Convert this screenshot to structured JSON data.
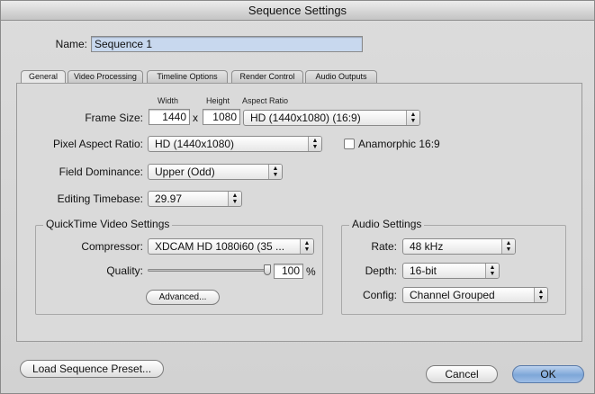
{
  "window": {
    "title": "Sequence Settings"
  },
  "name": {
    "label": "Name:",
    "value": "Sequence 1"
  },
  "tabs": [
    {
      "label": "General",
      "active": true
    },
    {
      "label": "Video Processing"
    },
    {
      "label": "Timeline Options"
    },
    {
      "label": "Render Control"
    },
    {
      "label": "Audio Outputs"
    }
  ],
  "general": {
    "frame_size": {
      "label": "Frame Size:",
      "width_header": "Width",
      "height_header": "Height",
      "aspect_header": "Aspect Ratio",
      "width": "1440",
      "separator": "x",
      "height": "1080",
      "aspect_ratio": "HD (1440x1080) (16:9)"
    },
    "pixel_aspect": {
      "label": "Pixel Aspect Ratio:",
      "value": "HD (1440x1080)"
    },
    "anamorphic": {
      "label": "Anamorphic 16:9",
      "checked": false
    },
    "field_dominance": {
      "label": "Field Dominance:",
      "value": "Upper (Odd)"
    },
    "editing_timebase": {
      "label": "Editing Timebase:",
      "value": "29.97"
    }
  },
  "quicktime": {
    "title": "QuickTime Video Settings",
    "compressor_label": "Compressor:",
    "compressor_value": "XDCAM HD 1080i60 (35 ...",
    "quality_label": "Quality:",
    "quality_value": "100",
    "quality_unit": "%",
    "quality_fraction": 1.0,
    "advanced_label": "Advanced..."
  },
  "audio": {
    "title": "Audio Settings",
    "rate_label": "Rate:",
    "rate_value": "48 kHz",
    "depth_label": "Depth:",
    "depth_value": "16-bit",
    "config_label": "Config:",
    "config_value": "Channel Grouped"
  },
  "footer": {
    "load_preset_label": "Load Sequence Preset...",
    "cancel_label": "Cancel",
    "ok_label": "OK"
  },
  "icons": {
    "popup": "up-down-arrows-icon",
    "checkbox": "checkbox-icon"
  },
  "colors": {
    "name_field_selection": "#c8d8ee",
    "ok_button": "#7ea7d8"
  }
}
